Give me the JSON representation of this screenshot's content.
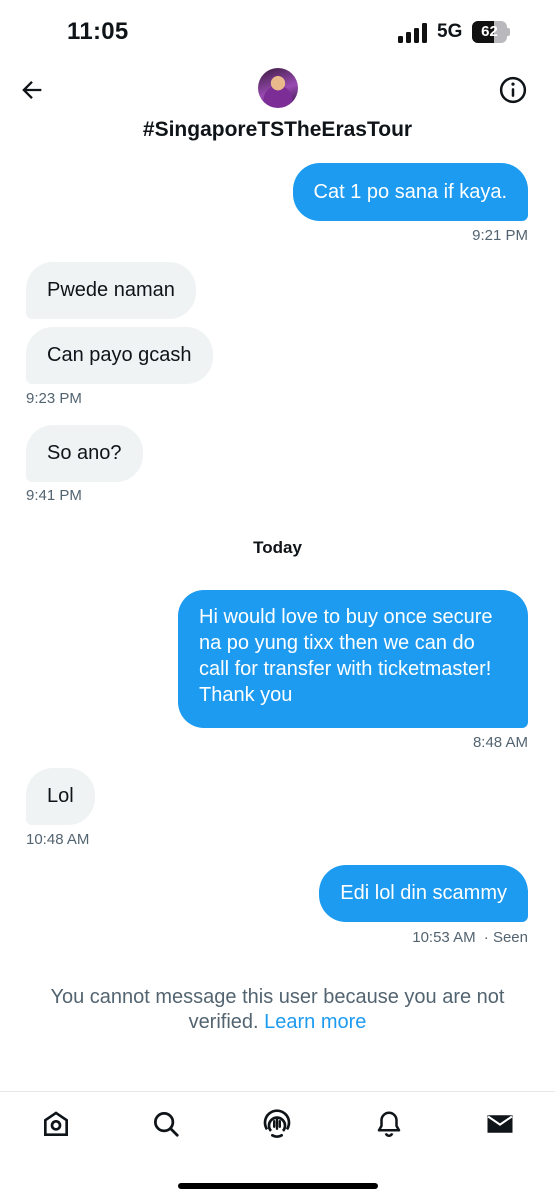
{
  "status_bar": {
    "time": "11:05",
    "network": "5G",
    "battery_percent": "62",
    "battery_level": 0.62
  },
  "header": {
    "title": "#SingaporeTSTheErasTour",
    "icons": {
      "back": "arrow-left-icon",
      "info": "info-circle-icon"
    }
  },
  "messages": [
    {
      "direction": "outgoing",
      "text": "Cat 1 po sana if kaya.",
      "time": "9:21 PM"
    },
    {
      "direction": "incoming",
      "text": "Pwede naman"
    },
    {
      "direction": "incoming",
      "text": "Can payo gcash",
      "time": "9:23 PM"
    },
    {
      "direction": "incoming",
      "text": "So ano?",
      "time": "9:41 PM"
    },
    {
      "direction": "outgoing",
      "text": "Hi would love to buy once secure na po yung tixx then we can do call for transfer with ticketmaster! Thank you",
      "time": "8:48 AM"
    },
    {
      "direction": "incoming",
      "text": "Lol",
      "time": "10:48 AM"
    },
    {
      "direction": "outgoing",
      "text": "Edi lol din scammy",
      "time": "10:53 AM",
      "status": "· Seen"
    }
  ],
  "day_separator": "Today",
  "notice": {
    "text": "You cannot message this user because you are not verified.",
    "link": "Learn more"
  },
  "bottom_nav": {
    "items": [
      "home-icon",
      "search-icon",
      "spaces-icon",
      "notifications-bell-icon",
      "messages-envelope-icon"
    ]
  },
  "colors": {
    "accent": "#1d9bf0",
    "incoming_bubble": "#eff3f4",
    "secondary_text": "#536471"
  }
}
